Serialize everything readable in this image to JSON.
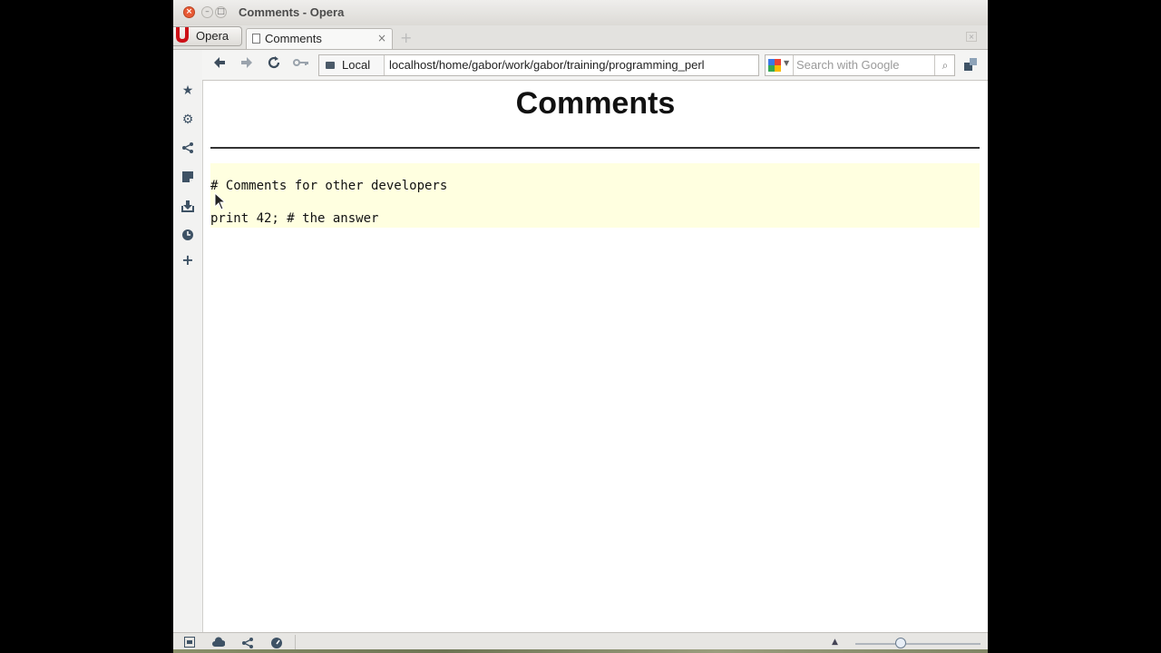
{
  "window": {
    "title": "Comments - Opera"
  },
  "tabs": {
    "menu_label": "Opera",
    "active_tab_label": "Comments",
    "close_glyph": "×",
    "new_tab_glyph": "+"
  },
  "toolbar": {
    "address_badge": "Local",
    "address_url": "localhost/home/gabor/work/gabor/training/programming_perl",
    "search_placeholder": "Search with Google"
  },
  "page": {
    "heading": "Comments",
    "code_lines": [
      "# Comments for other developers",
      "print 42; # the answer"
    ]
  },
  "colors": {
    "code_background": "#ffffe0",
    "icon_color": "#3e5265",
    "opera_red": "#cc0f16"
  },
  "icons": {
    "sidebar": [
      "bookmarks-icon",
      "settings-icon",
      "unite-icon",
      "notes-icon",
      "downloads-icon",
      "history-icon",
      "add-panel-icon"
    ],
    "statusbar": [
      "panel-toggle-icon",
      "cloud-icon",
      "unite-icon",
      "turbo-icon"
    ]
  }
}
